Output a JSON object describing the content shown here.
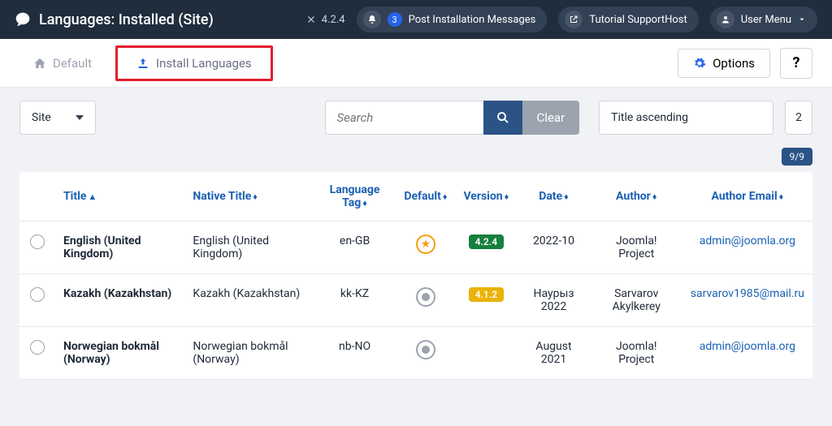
{
  "header": {
    "page_title": "Languages: Installed (Site)",
    "version": "4.2.4",
    "notif_count": "3",
    "notif_label": "Post Installation Messages",
    "tutorial_label": "Tutorial SupportHost",
    "usermenu_label": "User Menu"
  },
  "toolbar": {
    "default_label": "Default",
    "install_label": "Install Languages",
    "options_label": "Options",
    "help_label": "?"
  },
  "filters": {
    "client_select": "Site",
    "search_placeholder": "Search",
    "clear_label": "Clear",
    "sort_select": "Title ascending",
    "limit_select": "2",
    "count_badge": "9/9"
  },
  "columns": {
    "title": "Title",
    "native": "Native Title",
    "tag": "Language Tag",
    "default": "Default",
    "version": "Version",
    "date": "Date",
    "author": "Author",
    "email": "Author Email"
  },
  "rows": [
    {
      "title": "English (United Kingdom)",
      "native": "English (United Kingdom)",
      "tag": "en-GB",
      "default": true,
      "version": "4.2.4",
      "ver_class": "ver-green",
      "date": "2022-10",
      "author": "Joomla! Project",
      "email": "admin@joomla.org"
    },
    {
      "title": "Kazakh (Kazakhstan)",
      "native": "Kazakh (Kazakhstan)",
      "tag": "kk-KZ",
      "default": false,
      "version": "4.1.2",
      "ver_class": "ver-amber",
      "date": "Наурыз 2022",
      "author": "Sarvarov Akylkerey",
      "email": "sarvarov1985@mail.ru"
    },
    {
      "title": "Norwegian bokmål (Norway)",
      "native": "Norwegian bokmål (Norway)",
      "tag": "nb-NO",
      "default": false,
      "version": "",
      "ver_class": "",
      "date": "August 2021",
      "author": "Joomla! Project",
      "email": "admin@joomla.org"
    }
  ]
}
